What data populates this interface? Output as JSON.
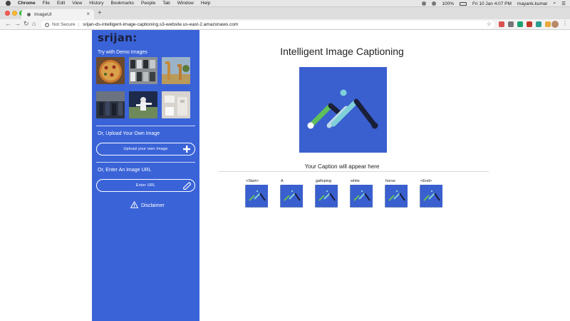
{
  "menubar": {
    "app": "Chrome",
    "items": [
      "File",
      "Edit",
      "View",
      "History",
      "Bookmarks",
      "People",
      "Tab",
      "Window",
      "Help"
    ],
    "battery": "100%",
    "datetime": "Fri 10 Jan  4:07 PM",
    "user": "mayank.kumar"
  },
  "browser": {
    "tab_title": "ImageUI",
    "url_prefix": "Not Secure",
    "url": "srijan-ds-intelligent-image-captioning.s3-website.us-east-2.amazonaws.com"
  },
  "sidebar": {
    "logo": "srijan:",
    "demo_title": "Try with Demo Images",
    "demo_images": [
      "pizza",
      "cars",
      "giraffes",
      "people",
      "baseball",
      "bathroom"
    ],
    "upload_heading": "Or, Upload Your Own Image",
    "upload_button": "Upload your own Image",
    "url_heading": "Or, Enter An Image URL",
    "url_button": "Enter URL",
    "disclaimer": "Disclaimer"
  },
  "main": {
    "title": "Intelligent Image Captioning",
    "caption_label": "Your Caption will appear here",
    "words": [
      "<Start>",
      "A",
      "galloping",
      "white",
      "horse",
      "<End>"
    ]
  },
  "colors": {
    "sidebar_bg": "#3a63d8",
    "preview_bg": "#3a5fcf",
    "accent_green": "#5fbf5a",
    "accent_teal": "#7fd0d9",
    "accent_navy": "#1a1f3a"
  }
}
